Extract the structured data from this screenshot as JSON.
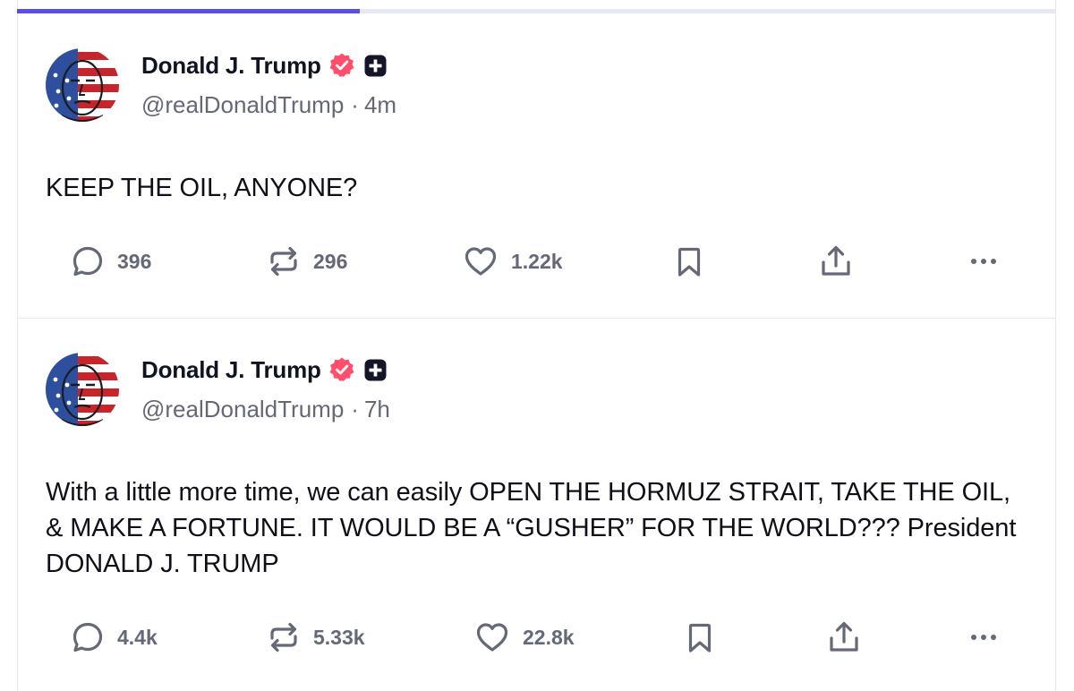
{
  "feed": {
    "progress": 0.33,
    "posts": [
      {
        "author": {
          "name": "Donald J. Trump",
          "handle": "@realDonaldTrump",
          "time": "4m"
        },
        "text": "KEEP THE OIL, ANYONE?",
        "replies": "396",
        "reposts": "296",
        "likes": "1.22k"
      },
      {
        "author": {
          "name": "Donald J. Trump",
          "handle": "@realDonaldTrump",
          "time": "7h"
        },
        "text": "With a little more time, we can easily OPEN THE HORMUZ STRAIT, TAKE THE OIL, & MAKE A FORTUNE. IT WOULD BE A “GUSHER” FOR THE WORLD??? President DONALD J. TRUMP",
        "replies": "4.4k",
        "reposts": "5.33k",
        "likes": "22.8k"
      }
    ]
  },
  "icons": {
    "reply": "reply-icon",
    "repost": "repost-icon",
    "like": "heart-icon",
    "bookmark": "bookmark-icon",
    "share": "share-icon",
    "more": "more-icon",
    "verified": "verified-badge-icon",
    "plus": "plus-badge-icon"
  },
  "colors": {
    "progress": "#5a4fdf",
    "verified": "#ff4f6d",
    "muted": "#646877",
    "text": "#0f0f1a"
  }
}
